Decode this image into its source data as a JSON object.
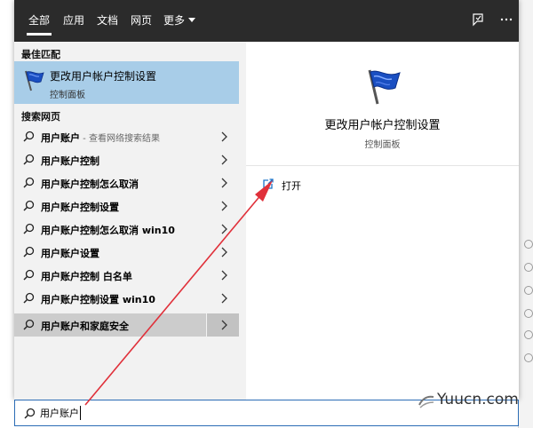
{
  "tabs": [
    {
      "label": "全部",
      "active": true
    },
    {
      "label": "应用",
      "active": false
    },
    {
      "label": "文档",
      "active": false
    },
    {
      "label": "网页",
      "active": false
    },
    {
      "label": "更多",
      "active": false
    }
  ],
  "top_icons": [
    "feedback-icon",
    "more-options-icon"
  ],
  "best_match": {
    "section_title": "最佳匹配",
    "title": "更改用户帐户控制设置",
    "subtitle": "控制面板",
    "icon": "uac-flag-icon"
  },
  "web": {
    "section_title": "搜索网页",
    "items": [
      {
        "bold": "用户账户",
        "suffix": " - 查看网络搜索结果"
      },
      {
        "bold": "用户账户控制",
        "suffix": ""
      },
      {
        "bold": "用户账户控制怎么取消",
        "suffix": ""
      },
      {
        "bold": "用户账户控制设置",
        "suffix": ""
      },
      {
        "bold": "用户账户控制怎么取消 win10",
        "suffix": ""
      },
      {
        "bold": "用户账户设置",
        "suffix": ""
      },
      {
        "bold": "用户账户控制 白名单",
        "suffix": ""
      },
      {
        "bold": "用户账户控制设置 win10",
        "suffix": ""
      },
      {
        "bold": "用户账户和家庭安全",
        "suffix": ""
      }
    ],
    "selected_index": 8
  },
  "detail": {
    "title": "更改用户帐户控制设置",
    "subtitle": "控制面板",
    "open_label": "打开"
  },
  "search": {
    "value": "用户账户",
    "placeholder": ""
  },
  "watermark": "Yuucn.com",
  "colors": {
    "topbar": "#2b2b2b",
    "best_match_bg": "#a8cde8",
    "selected_bg": "#cccccc",
    "accent_blue": "#1a73c9",
    "arrow_red": "#e0303a"
  }
}
